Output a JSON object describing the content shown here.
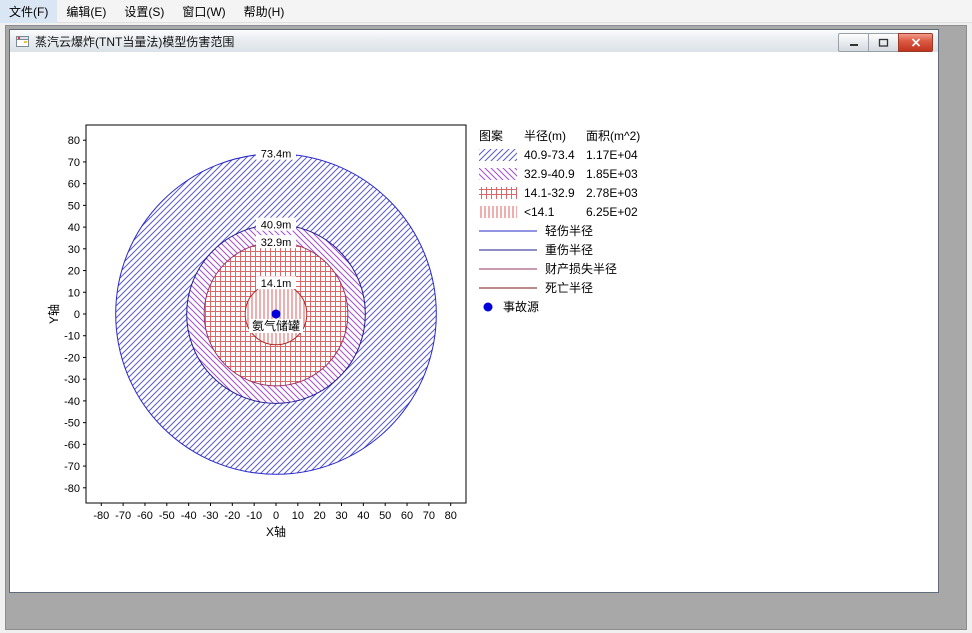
{
  "menu": {
    "items": [
      "文件(F)",
      "编辑(E)",
      "设置(S)",
      "窗口(W)",
      "帮助(H)"
    ]
  },
  "window": {
    "title": "蒸汽云爆炸(TNT当量法)模型伤害范围"
  },
  "icons": {
    "app": "form-icon",
    "minimize": "minimize-icon",
    "maximize": "maximize-icon",
    "close": "close-icon",
    "source_marker": "blue-dot-icon"
  },
  "chart_data": {
    "type": "annulus_hazard_map",
    "xlabel": "X轴",
    "ylabel": "Y轴",
    "xlim": [
      -87,
      87
    ],
    "ylim": [
      -87,
      87
    ],
    "xticks": [
      -80,
      -70,
      -60,
      -50,
      -40,
      -30,
      -20,
      -10,
      0,
      10,
      20,
      30,
      40,
      50,
      60,
      70,
      80
    ],
    "yticks": [
      -80,
      -70,
      -60,
      -50,
      -40,
      -30,
      -20,
      -10,
      0,
      10,
      20,
      30,
      40,
      50,
      60,
      70,
      80
    ],
    "grid": false,
    "center": {
      "x": 0,
      "y": 0,
      "label": "氨气储罐",
      "marker_color": "#0000dd"
    },
    "rings": [
      {
        "r": 73.4,
        "label": "73.4m",
        "stroke": "#2828c8",
        "hatch": "diag",
        "hatch_color": "#5a5ad2"
      },
      {
        "r": 40.9,
        "label": "40.9m",
        "stroke": "#1c1c8e",
        "hatch": "bdiag",
        "hatch_color": "#a44cd2"
      },
      {
        "r": 32.9,
        "label": "32.9m",
        "stroke": "#993366",
        "hatch": "cross",
        "hatch_color": "#d66a6a"
      },
      {
        "r": 14.1,
        "label": "14.1m",
        "stroke": "#b02828",
        "hatch": "vert",
        "hatch_color": "#e05c5c"
      }
    ]
  },
  "legend": {
    "headers": [
      "图案",
      "半径(m)",
      "面积(m^2)"
    ],
    "areas": [
      {
        "radius": "40.9-73.4",
        "area": "1.17E+04"
      },
      {
        "radius": "32.9-40.9",
        "area": "1.85E+03"
      },
      {
        "radius": "14.1-32.9",
        "area": "2.78E+03"
      },
      {
        "radius": "<14.1",
        "area": "6.25E+02"
      }
    ],
    "lines": [
      {
        "label": "轻伤半径",
        "color": "#2828c8"
      },
      {
        "label": "重伤半径",
        "color": "#1c1c8e"
      },
      {
        "label": "财产损失半径",
        "color": "#993366"
      },
      {
        "label": "死亡半径",
        "color": "#7a1414"
      }
    ],
    "marker": {
      "label": "事故源",
      "color": "#0000dd"
    }
  }
}
